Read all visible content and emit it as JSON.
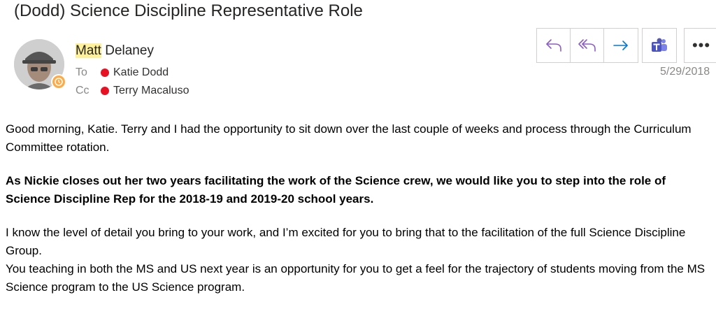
{
  "email": {
    "subject": "(Dodd) Science Discipline Representative Role",
    "sender": {
      "first": "Matt",
      "last": " Delaney"
    },
    "to": {
      "label": "To",
      "name": "Katie Dodd"
    },
    "cc": {
      "label": "Cc",
      "name": "Terry Macaluso"
    },
    "date": "5/29/2018",
    "actions": {
      "reply_icon": "reply-icon",
      "reply_all_icon": "reply-all-icon",
      "forward_icon": "forward-arrow-icon",
      "teams_icon": "teams-icon",
      "more_label": "•••"
    },
    "body": {
      "p1": "Good morning, Katie.  Terry and I had the opportunity to sit down over the last couple of weeks and process through the Curriculum Committee rotation.",
      "p2": "As Nickie closes out her two years facilitating the work of the Science crew, we would like you to step into the role of Science Discipline Rep for the 2018-19 and 2019-20 school years.",
      "p3": "I know the level of detail you bring to your work, and I’m excited for you to bring that to the facilitation of the full Science Discipline Group.",
      "p4": "You teaching in both the MS and US next year is an opportunity for you to get a feel for the trajectory of students moving from the MS Science program to the US Science program."
    }
  },
  "colors": {
    "accent_purple": "#8e5cc9",
    "accent_blue": "#0078d4",
    "teams_purple": "#5558af",
    "presence_away": "#ffaa44",
    "status_red": "#e81123",
    "name_highlight": "#fff19a"
  }
}
